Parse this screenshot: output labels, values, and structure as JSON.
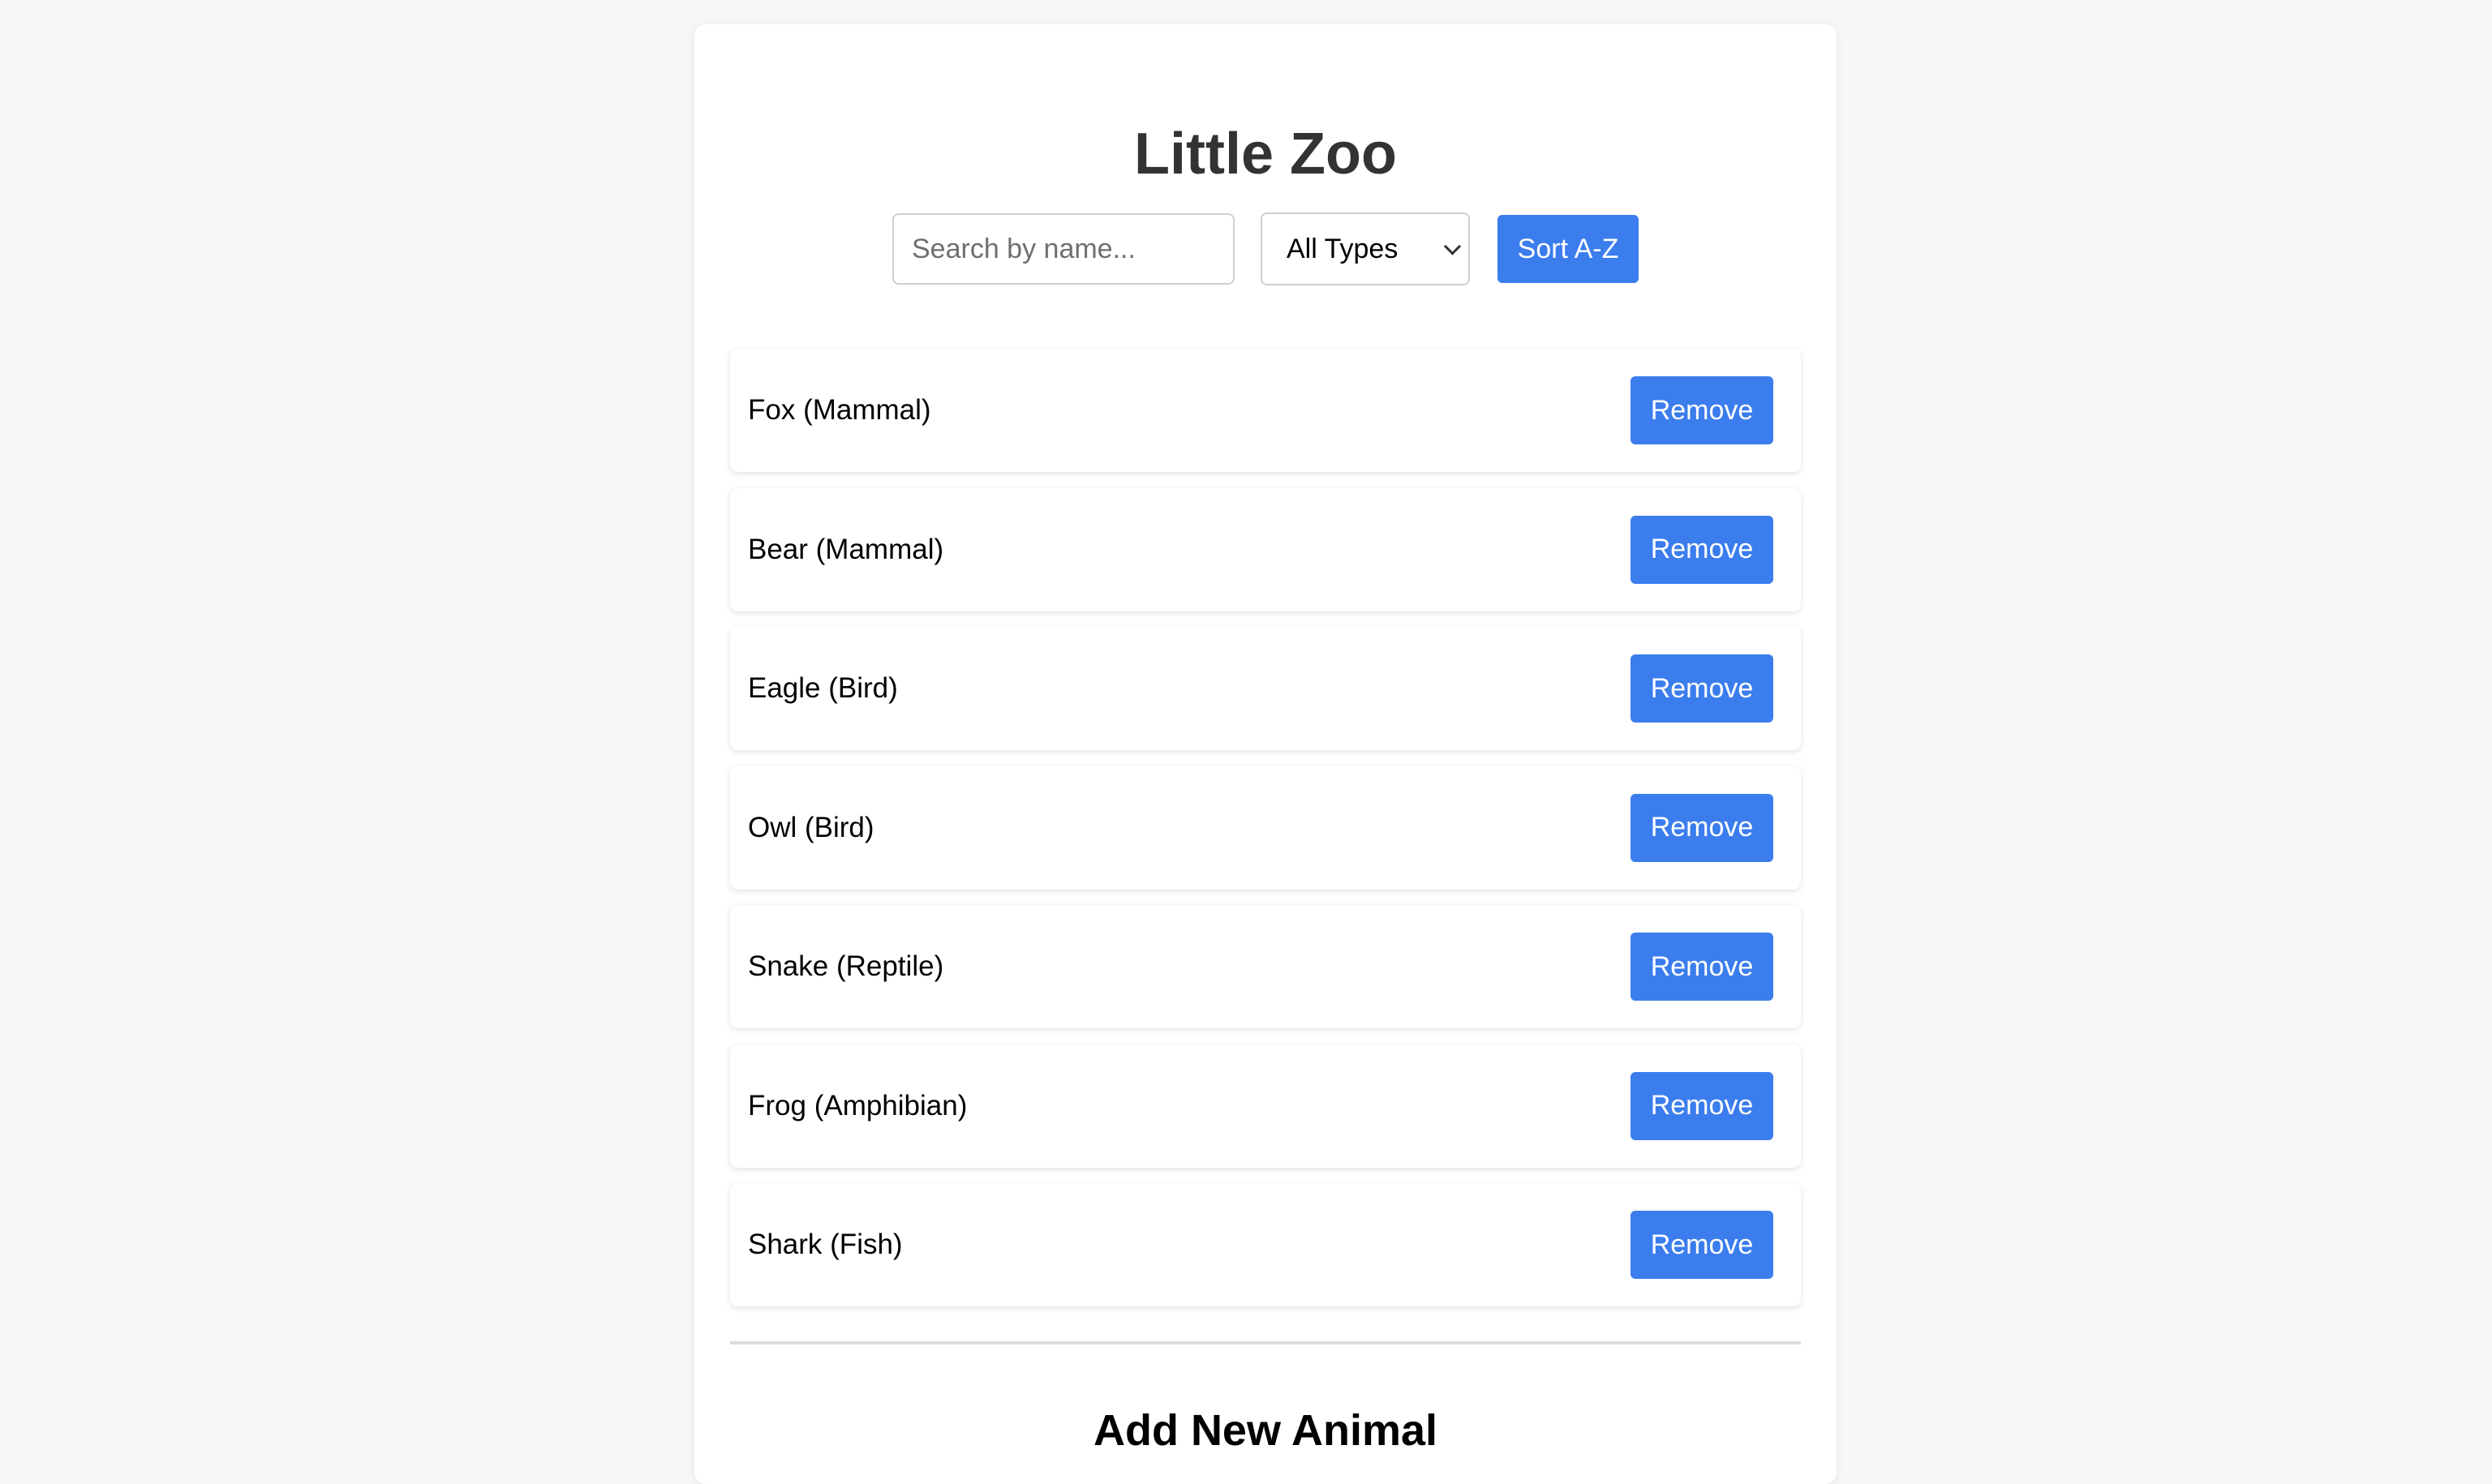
{
  "app": {
    "title": "Little Zoo"
  },
  "controls": {
    "search_placeholder": "Search by name...",
    "search_value": "",
    "type_filter_selected": "All Types",
    "sort_label": "Sort A-Z"
  },
  "animals": [
    {
      "label": "Fox (Mammal)",
      "remove_label": "Remove"
    },
    {
      "label": "Bear (Mammal)",
      "remove_label": "Remove"
    },
    {
      "label": "Eagle (Bird)",
      "remove_label": "Remove"
    },
    {
      "label": "Owl (Bird)",
      "remove_label": "Remove"
    },
    {
      "label": "Snake (Reptile)",
      "remove_label": "Remove"
    },
    {
      "label": "Frog (Amphibian)",
      "remove_label": "Remove"
    },
    {
      "label": "Shark (Fish)",
      "remove_label": "Remove"
    }
  ],
  "add_section": {
    "title": "Add New Animal"
  },
  "colors": {
    "accent": "#3b7ded",
    "background": "#f7f7f7",
    "card": "#ffffff",
    "title_text": "#333333"
  },
  "icons": {
    "type_dropdown": "chevron-down-icon"
  }
}
